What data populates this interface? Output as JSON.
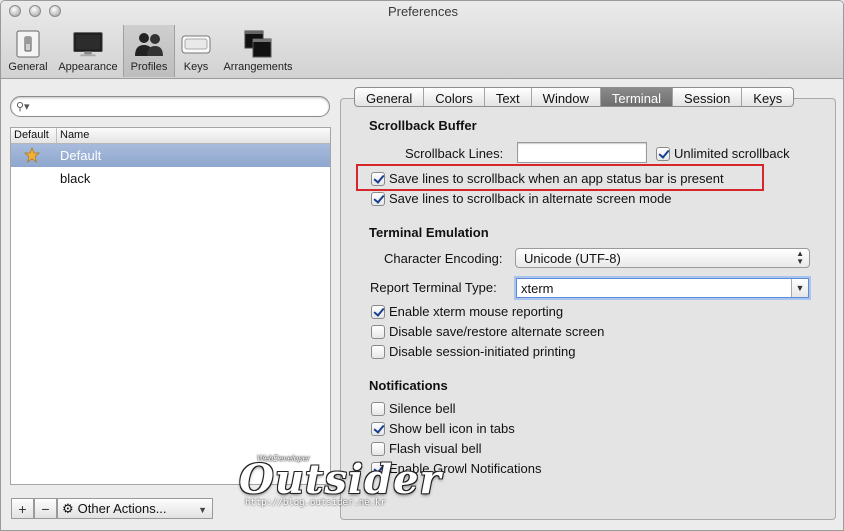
{
  "window": {
    "title": "Preferences"
  },
  "toolbar": {
    "items": [
      {
        "label": "General",
        "icon": "light-switch-icon"
      },
      {
        "label": "Appearance",
        "icon": "monitor-icon"
      },
      {
        "label": "Profiles",
        "icon": "people-icon"
      },
      {
        "label": "Keys",
        "icon": "keyboard-key-icon"
      },
      {
        "label": "Arrangements",
        "icon": "windows-icon"
      }
    ],
    "selected": "Profiles"
  },
  "profiles": {
    "search_placeholder": "",
    "columns": [
      "Default",
      "Name"
    ],
    "rows": [
      {
        "name": "Default",
        "is_default": true,
        "selected": true
      },
      {
        "name": "black",
        "is_default": false,
        "selected": false
      }
    ],
    "add_label": "+",
    "remove_label": "−",
    "actions_label": "Other Actions..."
  },
  "tabs": {
    "items": [
      "General",
      "Colors",
      "Text",
      "Window",
      "Terminal",
      "Session",
      "Keys"
    ],
    "active": "Terminal"
  },
  "scrollback": {
    "title": "Scrollback Buffer",
    "lines_label": "Scrollback Lines:",
    "lines_value": "",
    "unlimited_label": "Unlimited scrollback",
    "unlimited_checked": true,
    "save_status_bar_label": "Save lines to scrollback when an app status bar is present",
    "save_status_bar_checked": true,
    "save_alt_screen_label": "Save lines to scrollback in alternate screen mode",
    "save_alt_screen_checked": true
  },
  "emulation": {
    "title": "Terminal Emulation",
    "encoding_label": "Character Encoding:",
    "encoding_value": "Unicode (UTF-8)",
    "type_label": "Report Terminal Type:",
    "type_value": "xterm",
    "mouse_label": "Enable xterm mouse reporting",
    "mouse_checked": true,
    "disable_alt_label": "Disable save/restore alternate screen",
    "disable_alt_checked": false,
    "disable_print_label": "Disable session-initiated printing",
    "disable_print_checked": false
  },
  "notifications": {
    "title": "Notifications",
    "silence_label": "Silence bell",
    "silence_checked": false,
    "bell_icon_label": "Show bell icon in tabs",
    "bell_icon_checked": true,
    "flash_label": "Flash visual bell",
    "flash_checked": false,
    "growl_label": "Enable Growl Notifications",
    "growl_checked": true
  },
  "watermark": {
    "small": "WebDeveloper",
    "big": "Outsider",
    "url": "http://blog.outsider.ne.kr"
  },
  "colors": {
    "highlight": "#d7262b",
    "selection": "#8ea6ce",
    "checkmark": "#1a3f8f"
  }
}
